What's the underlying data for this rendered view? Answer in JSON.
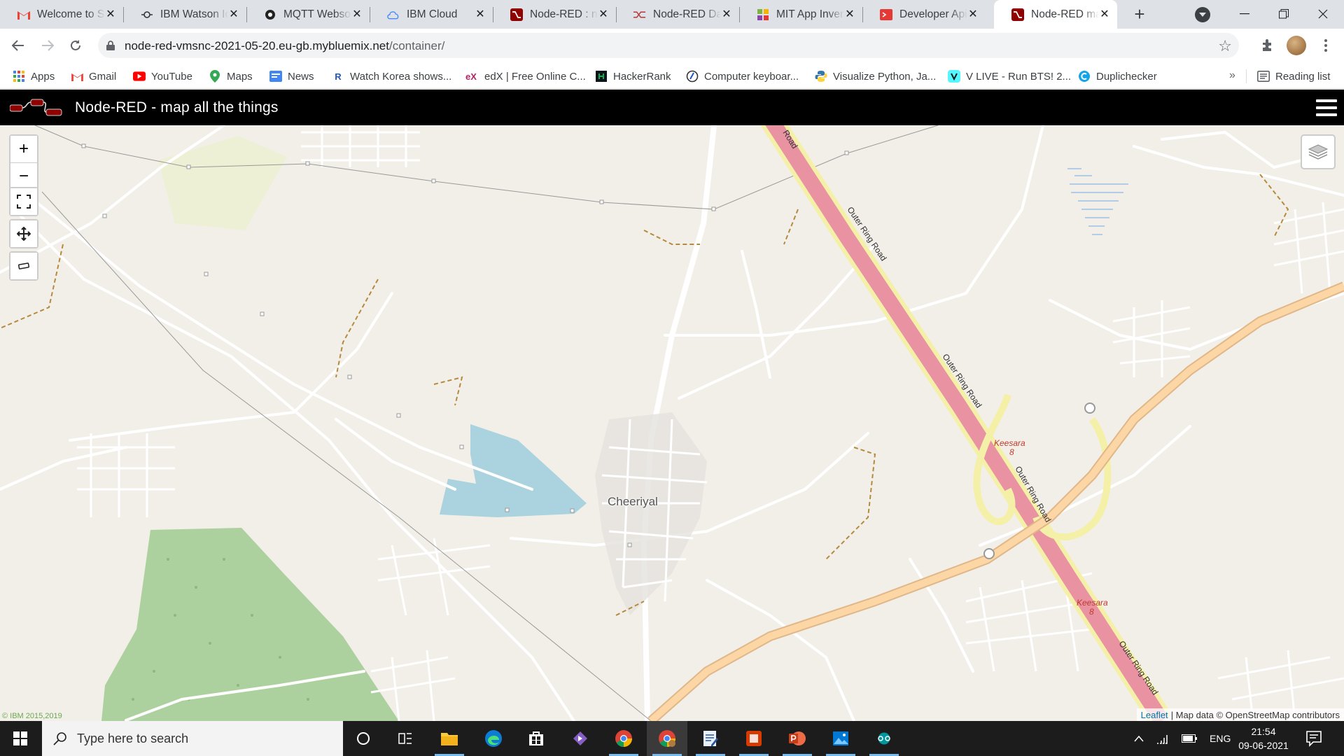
{
  "browser": {
    "tabs": [
      {
        "label": "Welcome to Sr",
        "icon": "gmail-icon",
        "active": false
      },
      {
        "label": "IBM Watson Io",
        "icon": "watson-iot-icon",
        "active": false
      },
      {
        "label": "MQTT Websoc",
        "icon": "mqtt-icon",
        "active": false
      },
      {
        "label": "IBM Cloud",
        "icon": "ibm-cloud-icon",
        "active": false
      },
      {
        "label": "Node-RED : nc",
        "icon": "node-red-icon",
        "active": false
      },
      {
        "label": "Node-RED Da",
        "icon": "node-red-dashboard-icon",
        "active": false
      },
      {
        "label": "MIT App Inven",
        "icon": "mit-app-inventor-icon",
        "active": false
      },
      {
        "label": "Developer Api",
        "icon": "developer-api-icon",
        "active": false
      },
      {
        "label": "Node-RED ma",
        "icon": "node-red-icon",
        "active": true
      }
    ],
    "url_host": "node-red-vmsnc-2021-05-20.eu-gb.mybluemix.net",
    "url_path": "/container/",
    "bookmarks": [
      {
        "label": "Apps",
        "icon": "apps-grid-icon"
      },
      {
        "label": "Gmail",
        "icon": "gmail-icon"
      },
      {
        "label": "YouTube",
        "icon": "youtube-icon"
      },
      {
        "label": "Maps",
        "icon": "maps-pin-icon"
      },
      {
        "label": "News",
        "icon": "news-icon"
      },
      {
        "label": "Watch Korea shows...",
        "icon": "rakuten-icon"
      },
      {
        "label": "edX | Free Online C...",
        "icon": "edx-icon"
      },
      {
        "label": "HackerRank",
        "icon": "hackerrank-icon"
      },
      {
        "label": "Computer keyboar...",
        "icon": "keyboard-site-icon"
      },
      {
        "label": "Visualize Python, Ja...",
        "icon": "python-icon"
      },
      {
        "label": "V LIVE - Run BTS! 2...",
        "icon": "vlive-icon"
      },
      {
        "label": "Duplichecker",
        "icon": "duplichecker-icon"
      }
    ],
    "bookmarks_more": "»",
    "reading_list": "Reading list"
  },
  "app": {
    "title": "Node-RED - map all the things"
  },
  "map": {
    "place_label": "Cheeriyal",
    "road_labels": [
      "Road",
      "Outer Ring Road",
      "Outer Ring Road",
      "Outer Ring Road",
      "Outer Ring Road"
    ],
    "junction_labels": [
      "Keesara",
      "8",
      "Keesara",
      "8"
    ],
    "zoom_in": "+",
    "zoom_out": "−",
    "attribution_link": "Leaflet",
    "attribution_text": "| Map data © OpenStreetMap contributors",
    "copyright": "© IBM 2015,2019",
    "colors": {
      "land": "#f2efe9",
      "water": "#aad3df",
      "forest": "#add19e",
      "farmland": "#eef0d5",
      "motorway": "#e892a2",
      "trunk": "#fcd6a4",
      "road": "#ffffff",
      "track": "#996600"
    }
  },
  "taskbar": {
    "search_placeholder": "Type here to search",
    "apps": [
      "cortana-icon",
      "task-view-icon",
      "file-explorer-icon",
      "edge-icon",
      "store-icon",
      "visual-studio-icon",
      "chrome-icon",
      "chrome-profile-icon",
      "notepad-icon",
      "screen-recorder-icon",
      "powerpoint-icon",
      "photos-icon",
      "arduino-icon"
    ],
    "language": "ENG",
    "time": "21:54",
    "date": "09-06-2021"
  }
}
